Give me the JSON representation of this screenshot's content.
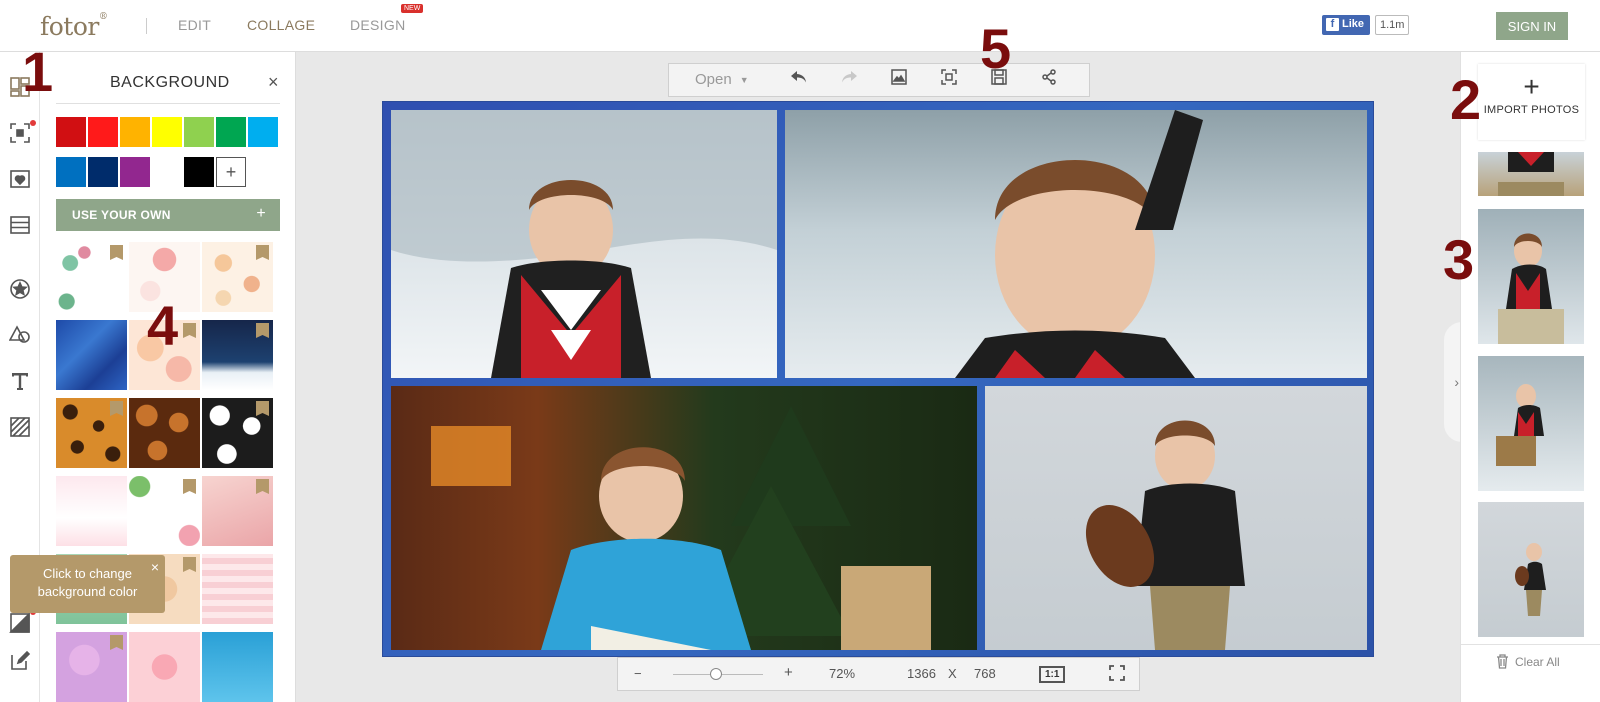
{
  "header": {
    "logo": "fotor",
    "logo_mark": "®",
    "nav": [
      {
        "label": "EDIT",
        "active": false
      },
      {
        "label": "COLLAGE",
        "active": true
      },
      {
        "label": "DESIGN",
        "active": false
      }
    ],
    "new_badge": "NEW",
    "fb_like": "Like",
    "fb_count": "1.1m",
    "sign_in": "SIGN IN"
  },
  "rail": {
    "icons": [
      "layout-icon",
      "stitch-icon",
      "sticker-heart-icon",
      "rows-icon",
      "star-badge-icon",
      "shapes-icon",
      "text-icon",
      "pattern-icon",
      "background-icon",
      "edit-icon"
    ]
  },
  "panel": {
    "title": "BACKGROUND",
    "close": "×",
    "colors": [
      "#d10f12",
      "#ff1a1a",
      "#ffb300",
      "#ffff00",
      "#8fd14f",
      "#00a651",
      "#00aeef",
      "#0070c0",
      "#002c6b",
      "#92278f",
      "#ffffff",
      "#000000"
    ],
    "add_color": "+",
    "use_own": "USE YOUR OWN",
    "use_own_plus": "+"
  },
  "tooltip": {
    "line1": "Click to change",
    "line2": "background color",
    "close": "×"
  },
  "toolbar": {
    "open": "Open",
    "caret": "▼",
    "buttons": [
      "undo-icon",
      "redo-icon",
      "image-icon",
      "screenshot-icon",
      "save-icon",
      "share-icon"
    ]
  },
  "zoom": {
    "minus": "−",
    "plus": "+",
    "level_text": "72%",
    "level": 72,
    "width": "1366",
    "x": "X",
    "height": "768",
    "one_to_one": "1:1"
  },
  "strip": {
    "import_plus": "+",
    "import_label": "IMPORT PHOTOS",
    "clear_all": "Clear All",
    "toggle": "›"
  },
  "markers": [
    "1",
    "2",
    "3",
    "4",
    "5"
  ]
}
